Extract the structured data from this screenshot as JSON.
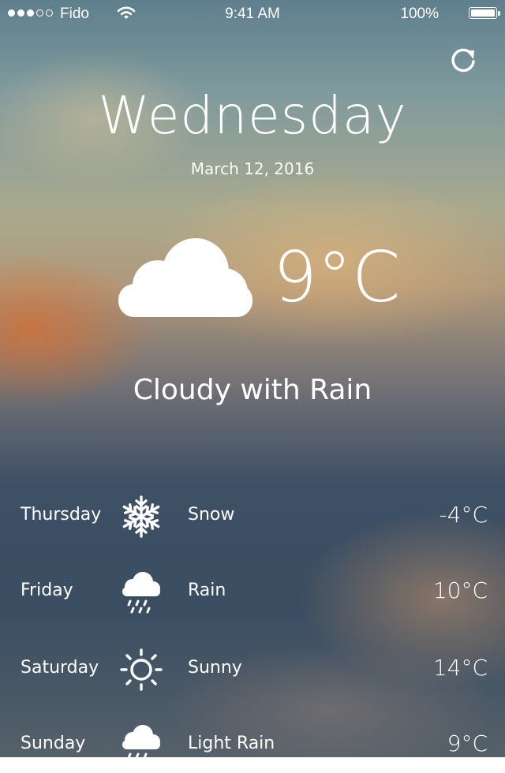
{
  "status_bar": {
    "signal_bars": 3,
    "signal_total": 5,
    "carrier": "Fido",
    "time": "9:41 AM",
    "battery_percent": "100%"
  },
  "header": {
    "refresh_icon": "refresh-icon",
    "day": "Wednesday",
    "date": "March 12, 2016"
  },
  "current": {
    "icon": "cloud-icon",
    "temperature": "9°C",
    "condition": "Cloudy with Rain"
  },
  "forecast": [
    {
      "day": "Thursday",
      "icon": "snowflake-icon",
      "condition": "Snow",
      "temperature": "-4°C"
    },
    {
      "day": "Friday",
      "icon": "rain-cloud-icon",
      "condition": "Rain",
      "temperature": "10°C"
    },
    {
      "day": "Saturday",
      "icon": "sun-icon",
      "condition": "Sunny",
      "temperature": "14°C"
    },
    {
      "day": "Sunday",
      "icon": "rain-cloud-icon",
      "condition": "Light Rain",
      "temperature": "9°C"
    }
  ],
  "colors": {
    "text": "#ffffff"
  }
}
